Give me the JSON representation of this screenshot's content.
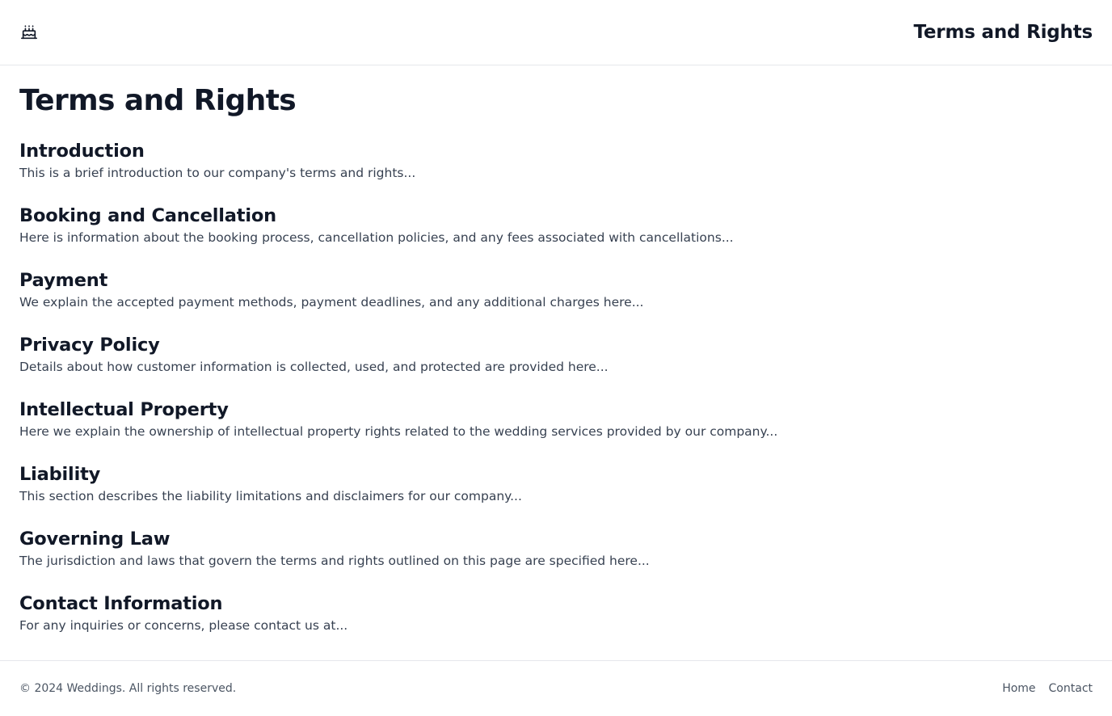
{
  "header": {
    "logo_icon": "cake-icon",
    "title": "Terms and Rights"
  },
  "main": {
    "title": "Terms and Rights",
    "sections": [
      {
        "title": "Introduction",
        "body": "This is a brief introduction to our company's terms and rights..."
      },
      {
        "title": "Booking and Cancellation",
        "body": "Here is information about the booking process, cancellation policies, and any fees associated with cancellations..."
      },
      {
        "title": "Payment",
        "body": "We explain the accepted payment methods, payment deadlines, and any additional charges here..."
      },
      {
        "title": "Privacy Policy",
        "body": "Details about how customer information is collected, used, and protected are provided here..."
      },
      {
        "title": "Intellectual Property",
        "body": "Here we explain the ownership of intellectual property rights related to the wedding services provided by our company..."
      },
      {
        "title": "Liability",
        "body": "This section describes the liability limitations and disclaimers for our company..."
      },
      {
        "title": "Governing Law",
        "body": "The jurisdiction and laws that govern the terms and rights outlined on this page are specified here..."
      },
      {
        "title": "Contact Information",
        "body": "For any inquiries or concerns, please contact us at..."
      }
    ]
  },
  "footer": {
    "copyright": "© 2024 Weddings. All rights reserved.",
    "links": [
      "Home",
      "Contact"
    ]
  }
}
